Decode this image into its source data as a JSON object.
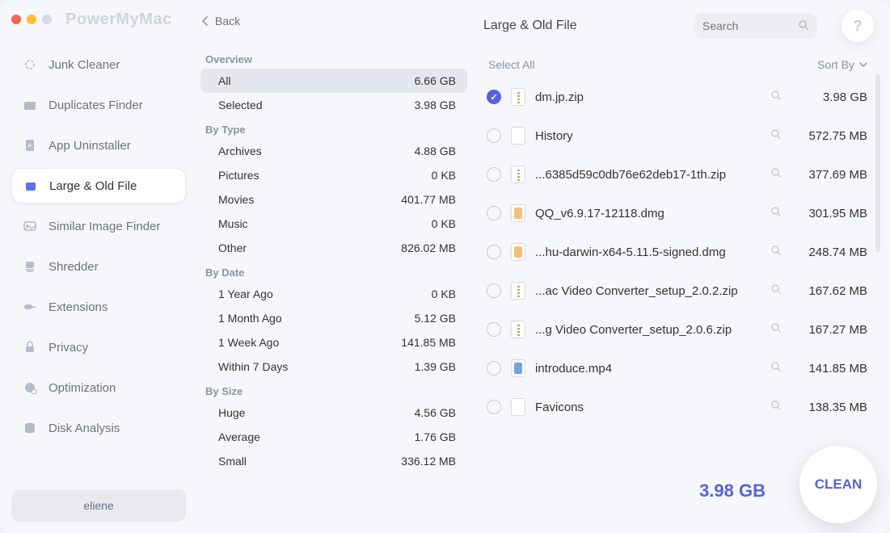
{
  "app_name": "PowerMyMac",
  "back_label": "Back",
  "sidebar": {
    "items": [
      {
        "label": "Junk Cleaner"
      },
      {
        "label": "Duplicates Finder"
      },
      {
        "label": "App Uninstaller"
      },
      {
        "label": "Large & Old File"
      },
      {
        "label": "Similar Image Finder"
      },
      {
        "label": "Shredder"
      },
      {
        "label": "Extensions"
      },
      {
        "label": "Privacy"
      },
      {
        "label": "Optimization"
      },
      {
        "label": "Disk Analysis"
      }
    ],
    "active_index": 3,
    "user": "eliene"
  },
  "categories": {
    "overview_label": "Overview",
    "overview": [
      {
        "label": "All",
        "size": "6.66 GB"
      },
      {
        "label": "Selected",
        "size": "3.98 GB"
      }
    ],
    "by_type_label": "By Type",
    "by_type": [
      {
        "label": "Archives",
        "size": "4.88 GB"
      },
      {
        "label": "Pictures",
        "size": "0 KB"
      },
      {
        "label": "Movies",
        "size": "401.77 MB"
      },
      {
        "label": "Music",
        "size": "0 KB"
      },
      {
        "label": "Other",
        "size": "826.02 MB"
      }
    ],
    "by_date_label": "By Date",
    "by_date": [
      {
        "label": "1 Year Ago",
        "size": "0 KB"
      },
      {
        "label": "1 Month Ago",
        "size": "5.12 GB"
      },
      {
        "label": "1 Week Ago",
        "size": "141.85 MB"
      },
      {
        "label": "Within 7 Days",
        "size": "1.39 GB"
      }
    ],
    "by_size_label": "By Size",
    "by_size": [
      {
        "label": "Huge",
        "size": "4.56 GB"
      },
      {
        "label": "Average",
        "size": "1.76 GB"
      },
      {
        "label": "Small",
        "size": "336.12 MB"
      }
    ]
  },
  "main": {
    "title": "Large & Old File",
    "search_placeholder": "Search",
    "select_all": "Select All",
    "sort_by": "Sort By",
    "files": [
      {
        "checked": true,
        "type": "zip",
        "name": "dm.jp.zip",
        "size": "3.98 GB"
      },
      {
        "checked": false,
        "type": "blank",
        "name": "History",
        "size": "572.75 MB"
      },
      {
        "checked": false,
        "type": "zip",
        "name": "...6385d59c0db76e62deb17-1th.zip",
        "size": "377.69 MB"
      },
      {
        "checked": false,
        "type": "dmg",
        "name": "QQ_v6.9.17-12118.dmg",
        "size": "301.95 MB"
      },
      {
        "checked": false,
        "type": "dmg",
        "name": "...hu-darwin-x64-5.11.5-signed.dmg",
        "size": "248.74 MB"
      },
      {
        "checked": false,
        "type": "zip",
        "name": "...ac Video Converter_setup_2.0.2.zip",
        "size": "167.62 MB"
      },
      {
        "checked": false,
        "type": "zip",
        "name": "...g Video Converter_setup_2.0.6.zip",
        "size": "167.27 MB"
      },
      {
        "checked": false,
        "type": "mp4",
        "name": "introduce.mp4",
        "size": "141.85 MB"
      },
      {
        "checked": false,
        "type": "blank",
        "name": "Favicons",
        "size": "138.35 MB"
      }
    ],
    "total_selected_size": "3.98 GB",
    "clean_label": "CLEAN"
  }
}
